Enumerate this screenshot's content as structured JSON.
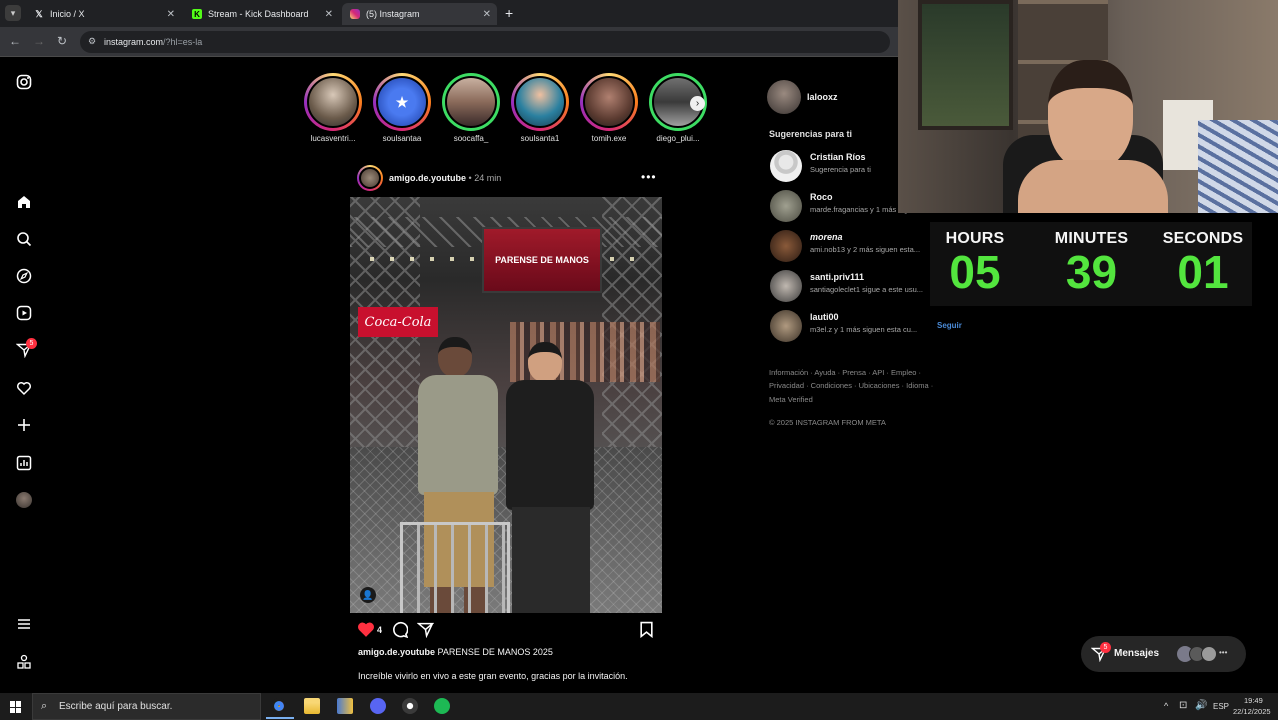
{
  "browser": {
    "tabs": [
      {
        "title": "Inicio / X",
        "icon": "x-logo-icon"
      },
      {
        "title": "Stream - Kick Dashboard",
        "icon": "kick-logo-icon"
      },
      {
        "title": "(5) Instagram",
        "icon": "instagram-logo-icon"
      }
    ],
    "new_tab": "+",
    "url_host": "instagram.com",
    "url_path": "/?hl=es-la"
  },
  "sidebar": {
    "notification_count": "5"
  },
  "stories": [
    {
      "name": "lucasventri..."
    },
    {
      "name": "soulsantaa"
    },
    {
      "name": "soocaffa_"
    },
    {
      "name": "soulsanta1"
    },
    {
      "name": "tomih.exe"
    },
    {
      "name": "diego_plui..."
    }
  ],
  "post": {
    "author": "amigo.de.youtube",
    "time": "24 min",
    "likes": "4",
    "caption_user": "amigo.de.youtube",
    "caption_text": "PARENSE DE MANOS 2025",
    "comment_text": "Increíble vivirlo en vivo a este gran evento, gracias por la invitación.",
    "banner_text": "PARENSE DE MANOS",
    "sign_text": "Coca-Cola"
  },
  "right_panel": {
    "username": "lalooxz",
    "suggestions_title": "Sugerencias para ti",
    "suggestions": [
      {
        "name": "Cristian Ríos",
        "sub": "Sugerencia para ti"
      },
      {
        "name": "Roco",
        "sub": "marde.fragancias y 1 más sigue..."
      },
      {
        "name": "morena",
        "sub": "ami.nob13 y 2 más siguen esta..."
      },
      {
        "name": "santi.priv111",
        "sub": "santiagoleclet1 sigue a este usu..."
      },
      {
        "name": "lauti00",
        "sub": "m3el.z y 1 más siguen esta cu..."
      }
    ],
    "follow_label": "Seguir",
    "footer_links_1": "Información · Ayuda · Prensa · API · Empleo ·",
    "footer_links_2": "Privacidad · Condiciones · Ubicaciones · Idioma ·",
    "footer_links_3": "Meta Verified",
    "copyright": "© 2025 INSTAGRAM FROM META"
  },
  "timer": {
    "hours_label": "HOURS",
    "minutes_label": "MINUTES",
    "seconds_label": "SECONDS",
    "hours": "05",
    "minutes": "39",
    "seconds": "01"
  },
  "messages": {
    "label": "Mensajes",
    "count": "5"
  },
  "taskbar": {
    "search_placeholder": "Escribe aquí para buscar.",
    "language": "ESP",
    "time": "19:49",
    "date": "22/12/2025"
  },
  "colors": {
    "timer_green": "#53e53e",
    "ig_red": "#ff3040",
    "link_blue": "#4a8ad6"
  }
}
